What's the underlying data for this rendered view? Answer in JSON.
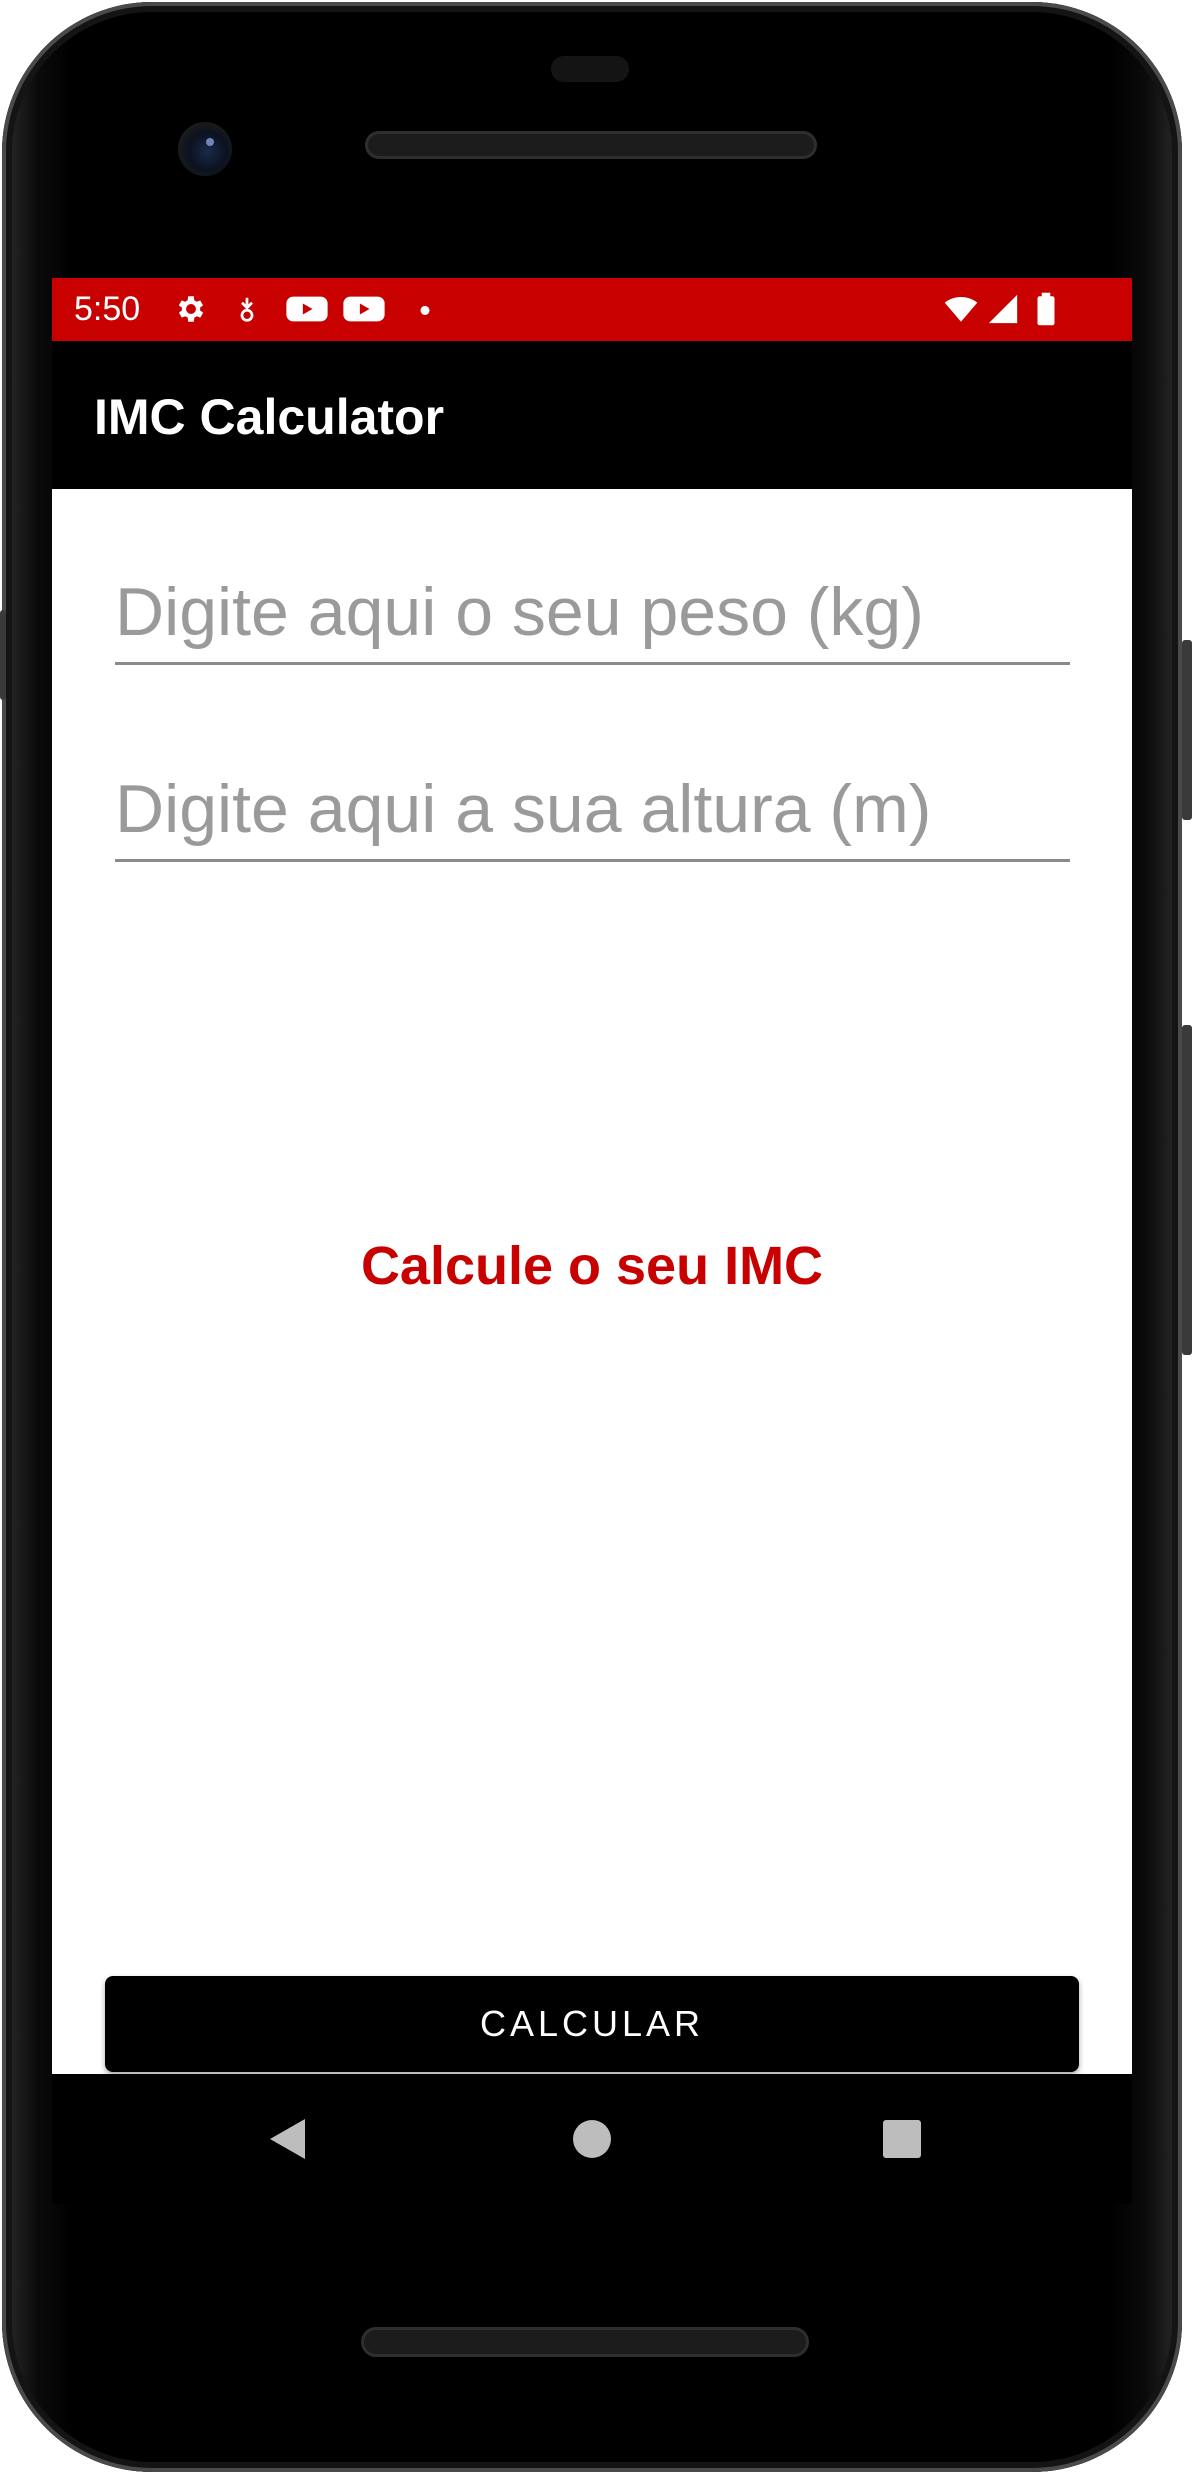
{
  "status_bar": {
    "time": "5:50",
    "background_color": "#c80000",
    "left_icons": [
      "gear-icon",
      "download-icon",
      "youtube-icon",
      "youtube-icon",
      "notification-dot-icon"
    ],
    "right_icons": [
      "wifi-icon",
      "signal-icon",
      "battery-icon"
    ]
  },
  "app_bar": {
    "title": "IMC Calculator",
    "background_color": "#000000"
  },
  "form": {
    "weight_placeholder": "Digite aqui o seu peso (kg)",
    "weight_value": "",
    "height_placeholder": "Digite aqui a sua altura (m)",
    "height_value": ""
  },
  "result": {
    "text": "Calcule o seu IMC",
    "color": "#c80000"
  },
  "button": {
    "label": "CALCULAR"
  },
  "navigation": {
    "icons": [
      "back-icon",
      "home-icon",
      "recents-icon"
    ]
  }
}
